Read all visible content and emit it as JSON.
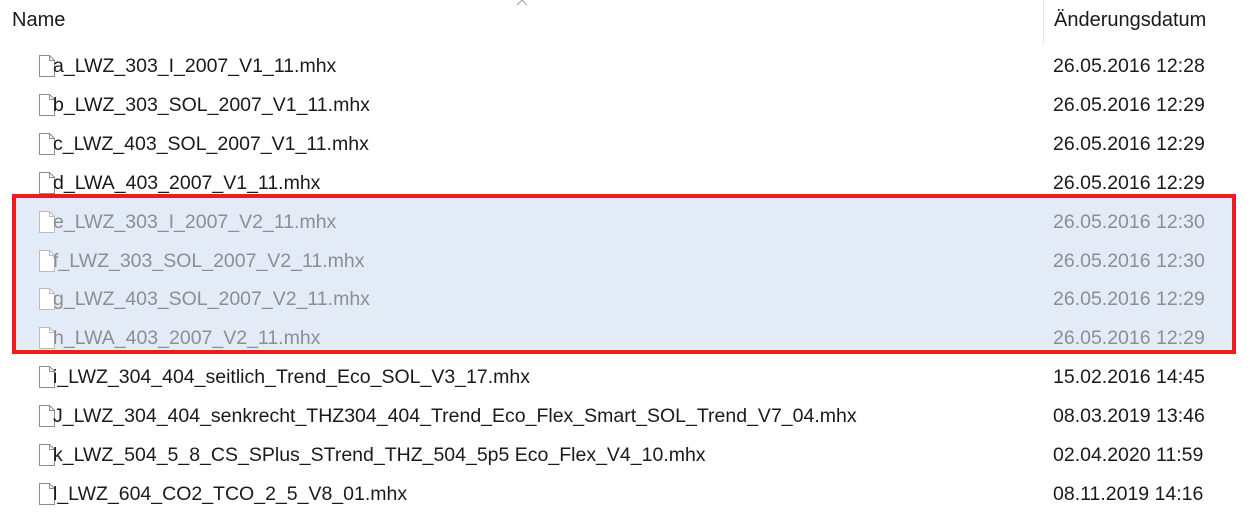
{
  "columns": {
    "name_label": "Name",
    "date_label": "Änderungsdatum"
  },
  "highlight": {
    "border_color": "#ee1c1c",
    "fill_color": "#e3ebf6"
  },
  "files": [
    {
      "name": "a_LWZ_303_I_2007_V1_11.mhx",
      "date": "26.05.2016 12:28",
      "cut": false
    },
    {
      "name": "b_LWZ_303_SOL_2007_V1_11.mhx",
      "date": "26.05.2016 12:29",
      "cut": false
    },
    {
      "name": "c_LWZ_403_SOL_2007_V1_11.mhx",
      "date": "26.05.2016 12:29",
      "cut": false
    },
    {
      "name": "d_LWA_403_2007_V1_11.mhx",
      "date": "26.05.2016 12:29",
      "cut": false
    },
    {
      "name": "e_LWZ_303_I_2007_V2_11.mhx",
      "date": "26.05.2016 12:30",
      "cut": true
    },
    {
      "name": "f_LWZ_303_SOL_2007_V2_11.mhx",
      "date": "26.05.2016 12:30",
      "cut": true
    },
    {
      "name": "g_LWZ_403_SOL_2007_V2_11.mhx",
      "date": "26.05.2016 12:29",
      "cut": true
    },
    {
      "name": "h_LWA_403_2007_V2_11.mhx",
      "date": "26.05.2016 12:29",
      "cut": true
    },
    {
      "name": "i_LWZ_304_404_seitlich_Trend_Eco_SOL_V3_17.mhx",
      "date": "15.02.2016 14:45",
      "cut": false
    },
    {
      "name": "J_LWZ_304_404_senkrecht_THZ304_404_Trend_Eco_Flex_Smart_SOL_Trend_V7_04.mhx",
      "date": "08.03.2019 13:46",
      "cut": false
    },
    {
      "name": "k_LWZ_504_5_8_CS_SPlus_STrend_THZ_504_5p5 Eco_Flex_V4_10.mhx",
      "date": "02.04.2020 11:59",
      "cut": false
    },
    {
      "name": "l_LWZ_604_CO2_TCO_2_5_V8_01.mhx",
      "date": "08.11.2019 14:16",
      "cut": false
    }
  ]
}
